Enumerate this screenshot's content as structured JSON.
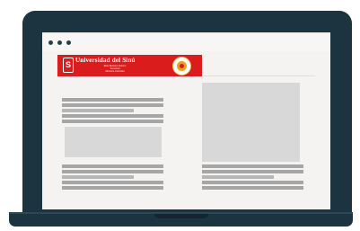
{
  "banner": {
    "logo_mark": "S",
    "name": "Universidad del Sinú",
    "subtitle": "Elías Bechara Zainúm",
    "subtitle2": "Seccional",
    "subtitle3": "Montería Colombia"
  },
  "colors": {
    "laptop_frame": "#1c3440",
    "screen_bg": "#f4f3f1",
    "banner_red": "#da1c1c",
    "seal_gold": "#e8a317",
    "text_line": "#a6a6a6",
    "image_placeholder": "#d8d8d8"
  },
  "icons": {
    "window_dots": "three-dot-window-controls-icon",
    "logo": "university-logo-icon",
    "seal": "university-seal-icon"
  }
}
